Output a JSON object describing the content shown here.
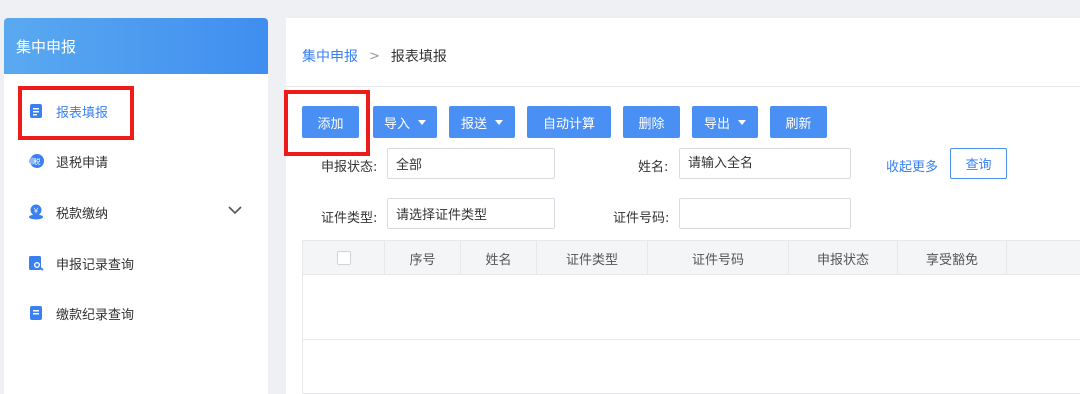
{
  "sidebar": {
    "title": "集中申报",
    "items": [
      {
        "label": "报表填报",
        "icon": "report-form-icon"
      },
      {
        "label": "退税申请",
        "icon": "tax-refund-icon"
      },
      {
        "label": "税款缴纳",
        "icon": "tax-payment-icon"
      },
      {
        "label": "申报记录查询",
        "icon": "record-search-icon"
      },
      {
        "label": "缴款纪录查询",
        "icon": "payment-record-icon"
      }
    ],
    "active_index": 0
  },
  "breadcrumb": {
    "parent": "集中申报",
    "separator": ">",
    "current": "报表填报"
  },
  "toolbar": {
    "add": "添加",
    "import": "导入",
    "submit": "报送",
    "auto_calc": "自动计算",
    "delete": "删除",
    "export": "导出",
    "refresh": "刷新"
  },
  "filters": {
    "status_label": "申报状态:",
    "status_value": "全部",
    "name_label": "姓名:",
    "name_placeholder": "请输入全名",
    "collapse_link": "收起更多",
    "query_button": "查询",
    "id_type_label": "证件类型:",
    "id_type_value": "请选择证件类型",
    "id_number_label": "证件号码:",
    "id_number_value": ""
  },
  "table": {
    "columns": [
      "序号",
      "姓名",
      "证件类型",
      "证件号码",
      "申报状态",
      "享受豁免"
    ],
    "rows": []
  },
  "colors": {
    "accent": "#4a8ff3",
    "highlight": "#ee1b1b"
  }
}
